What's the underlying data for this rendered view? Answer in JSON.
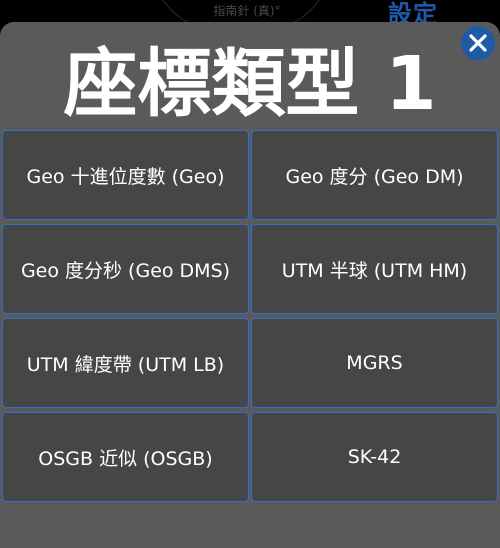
{
  "background": {
    "compass_label": "指南針 (真)°",
    "settings_label": "設定"
  },
  "modal": {
    "title": "座標類型 1",
    "close_icon": "close-x-icon",
    "options": [
      "Geo 十進位度數 (Geo)",
      "Geo 度分 (Geo DM)",
      "Geo 度分秒 (Geo DMS)",
      "UTM 半球 (UTM HM)",
      "UTM 緯度帶 (UTM LB)",
      "MGRS",
      "OSGB 近似 (OSGB)",
      "SK-42"
    ]
  },
  "colors": {
    "accent": "#2f6fd0",
    "close_button": "#1e5ba6",
    "modal_bg": "#5a5a5a",
    "option_bg": "#464646"
  }
}
